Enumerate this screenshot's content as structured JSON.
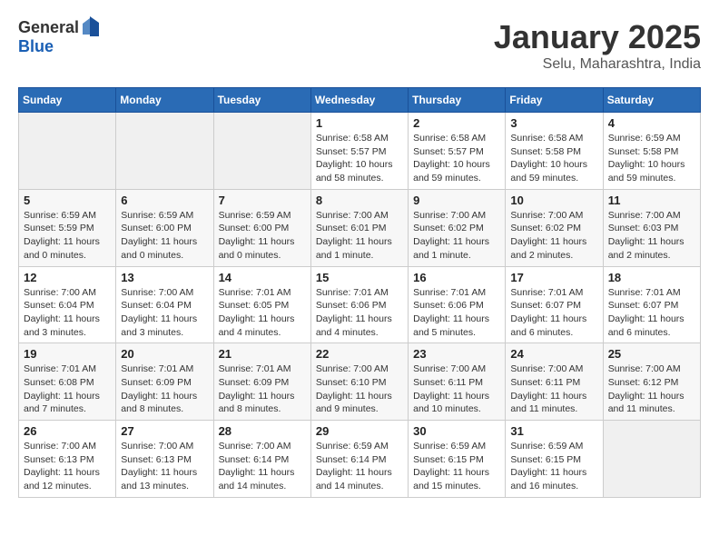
{
  "logo": {
    "general": "General",
    "blue": "Blue"
  },
  "header": {
    "title": "January 2025",
    "subtitle": "Selu, Maharashtra, India"
  },
  "weekdays": [
    "Sunday",
    "Monday",
    "Tuesday",
    "Wednesday",
    "Thursday",
    "Friday",
    "Saturday"
  ],
  "weeks": [
    [
      {
        "day": "",
        "info": ""
      },
      {
        "day": "",
        "info": ""
      },
      {
        "day": "",
        "info": ""
      },
      {
        "day": "1",
        "info": "Sunrise: 6:58 AM\nSunset: 5:57 PM\nDaylight: 10 hours\nand 58 minutes."
      },
      {
        "day": "2",
        "info": "Sunrise: 6:58 AM\nSunset: 5:57 PM\nDaylight: 10 hours\nand 59 minutes."
      },
      {
        "day": "3",
        "info": "Sunrise: 6:58 AM\nSunset: 5:58 PM\nDaylight: 10 hours\nand 59 minutes."
      },
      {
        "day": "4",
        "info": "Sunrise: 6:59 AM\nSunset: 5:58 PM\nDaylight: 10 hours\nand 59 minutes."
      }
    ],
    [
      {
        "day": "5",
        "info": "Sunrise: 6:59 AM\nSunset: 5:59 PM\nDaylight: 11 hours\nand 0 minutes."
      },
      {
        "day": "6",
        "info": "Sunrise: 6:59 AM\nSunset: 6:00 PM\nDaylight: 11 hours\nand 0 minutes."
      },
      {
        "day": "7",
        "info": "Sunrise: 6:59 AM\nSunset: 6:00 PM\nDaylight: 11 hours\nand 0 minutes."
      },
      {
        "day": "8",
        "info": "Sunrise: 7:00 AM\nSunset: 6:01 PM\nDaylight: 11 hours\nand 1 minute."
      },
      {
        "day": "9",
        "info": "Sunrise: 7:00 AM\nSunset: 6:02 PM\nDaylight: 11 hours\nand 1 minute."
      },
      {
        "day": "10",
        "info": "Sunrise: 7:00 AM\nSunset: 6:02 PM\nDaylight: 11 hours\nand 2 minutes."
      },
      {
        "day": "11",
        "info": "Sunrise: 7:00 AM\nSunset: 6:03 PM\nDaylight: 11 hours\nand 2 minutes."
      }
    ],
    [
      {
        "day": "12",
        "info": "Sunrise: 7:00 AM\nSunset: 6:04 PM\nDaylight: 11 hours\nand 3 minutes."
      },
      {
        "day": "13",
        "info": "Sunrise: 7:00 AM\nSunset: 6:04 PM\nDaylight: 11 hours\nand 3 minutes."
      },
      {
        "day": "14",
        "info": "Sunrise: 7:01 AM\nSunset: 6:05 PM\nDaylight: 11 hours\nand 4 minutes."
      },
      {
        "day": "15",
        "info": "Sunrise: 7:01 AM\nSunset: 6:06 PM\nDaylight: 11 hours\nand 4 minutes."
      },
      {
        "day": "16",
        "info": "Sunrise: 7:01 AM\nSunset: 6:06 PM\nDaylight: 11 hours\nand 5 minutes."
      },
      {
        "day": "17",
        "info": "Sunrise: 7:01 AM\nSunset: 6:07 PM\nDaylight: 11 hours\nand 6 minutes."
      },
      {
        "day": "18",
        "info": "Sunrise: 7:01 AM\nSunset: 6:07 PM\nDaylight: 11 hours\nand 6 minutes."
      }
    ],
    [
      {
        "day": "19",
        "info": "Sunrise: 7:01 AM\nSunset: 6:08 PM\nDaylight: 11 hours\nand 7 minutes."
      },
      {
        "day": "20",
        "info": "Sunrise: 7:01 AM\nSunset: 6:09 PM\nDaylight: 11 hours\nand 8 minutes."
      },
      {
        "day": "21",
        "info": "Sunrise: 7:01 AM\nSunset: 6:09 PM\nDaylight: 11 hours\nand 8 minutes."
      },
      {
        "day": "22",
        "info": "Sunrise: 7:00 AM\nSunset: 6:10 PM\nDaylight: 11 hours\nand 9 minutes."
      },
      {
        "day": "23",
        "info": "Sunrise: 7:00 AM\nSunset: 6:11 PM\nDaylight: 11 hours\nand 10 minutes."
      },
      {
        "day": "24",
        "info": "Sunrise: 7:00 AM\nSunset: 6:11 PM\nDaylight: 11 hours\nand 11 minutes."
      },
      {
        "day": "25",
        "info": "Sunrise: 7:00 AM\nSunset: 6:12 PM\nDaylight: 11 hours\nand 11 minutes."
      }
    ],
    [
      {
        "day": "26",
        "info": "Sunrise: 7:00 AM\nSunset: 6:13 PM\nDaylight: 11 hours\nand 12 minutes."
      },
      {
        "day": "27",
        "info": "Sunrise: 7:00 AM\nSunset: 6:13 PM\nDaylight: 11 hours\nand 13 minutes."
      },
      {
        "day": "28",
        "info": "Sunrise: 7:00 AM\nSunset: 6:14 PM\nDaylight: 11 hours\nand 14 minutes."
      },
      {
        "day": "29",
        "info": "Sunrise: 6:59 AM\nSunset: 6:14 PM\nDaylight: 11 hours\nand 14 minutes."
      },
      {
        "day": "30",
        "info": "Sunrise: 6:59 AM\nSunset: 6:15 PM\nDaylight: 11 hours\nand 15 minutes."
      },
      {
        "day": "31",
        "info": "Sunrise: 6:59 AM\nSunset: 6:15 PM\nDaylight: 11 hours\nand 16 minutes."
      },
      {
        "day": "",
        "info": ""
      }
    ]
  ]
}
